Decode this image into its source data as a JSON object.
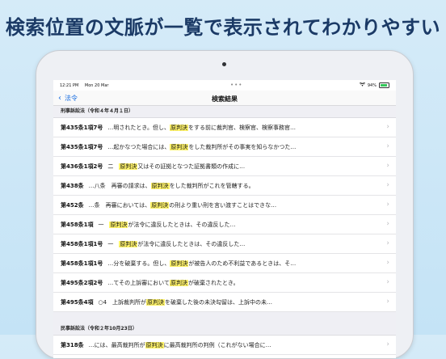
{
  "headline": "検索位置の文脈が一覧で表示されてわかりやすい",
  "status": {
    "time": "12:21 PM",
    "date": "Mon 20 Mar",
    "dots": "•••",
    "battery": "94%"
  },
  "nav": {
    "back_label": "法令",
    "title": "検索結果"
  },
  "keyword": "原判決",
  "sections": [
    {
      "title": "刑事訴訟法（令和４年４月１日）",
      "rows": [
        {
          "article": "第435条1項7号",
          "pre": "…明されたとき。但し、",
          "post": "をする前に裁判官、検察官、検察事務官…"
        },
        {
          "article": "第435条1項7号",
          "pre": "…起かなつた場合には、",
          "post": "をした裁判所がその事実を知らなかつた…"
        },
        {
          "article": "第436条1項2号",
          "pre": "二　",
          "post": "又はその証拠となつた証拠書類の作成に…"
        },
        {
          "article": "第438条",
          "pre": "…八条　再審の請求は、",
          "post": "をした裁判所がこれを管轄する。"
        },
        {
          "article": "第452条",
          "pre": "…条　再審においては、",
          "post": "の刑より重い刑を言い渡すことはできな…"
        },
        {
          "article": "第458条1項",
          "pre": "一　",
          "post": "が法令に違反したときは、その違反した…"
        },
        {
          "article": "第458条1項1号",
          "pre": "一　",
          "post": "が法令に違反したときは、その違反した…"
        },
        {
          "article": "第458条1項1号",
          "pre": "…分を破棄する。但し、",
          "post": "が被告人のため不利益であるときは、そ…"
        },
        {
          "article": "第495条2項2号",
          "pre": "…てその上訴審において",
          "post": "が破棄されたとき。"
        },
        {
          "article": "第495条4項",
          "pre": "○4　上訴裁判所が",
          "post": "を破棄した後の未決勾留は、上訴中の未…"
        }
      ]
    },
    {
      "title": "民事訴訟法（令和２年10月23日）",
      "rows": [
        {
          "article": "第318条",
          "pre": "…には、最高裁判所が",
          "post": "に最高裁判所の判例（これがない場合に…"
        }
      ]
    }
  ]
}
